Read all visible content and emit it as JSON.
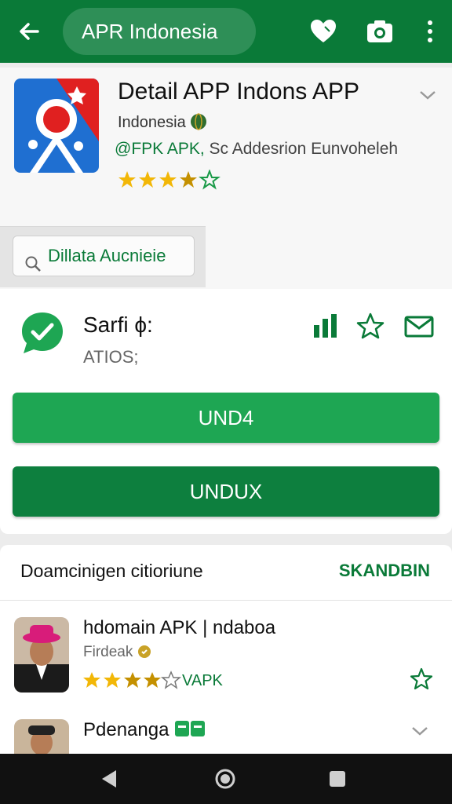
{
  "topbar": {
    "title": "APR Indonesia",
    "icons": [
      "back-arrow-icon",
      "heart-icon",
      "camera-icon",
      "more-vert-icon"
    ],
    "color": "#0a7a38"
  },
  "app": {
    "name": "Detail  APP Indons APP",
    "subtitle": "Indonesia",
    "developer_label": "@FPK APK,",
    "developer_text": "Sc Addesrion Eunvoheleh",
    "rating": 4
  },
  "search_button": {
    "label": "Dillata Aucnieie"
  },
  "card": {
    "title": "Sarfi ϕ:",
    "subtitle": "ATIOS;",
    "button_primary": "UND4",
    "button_secondary": "UNDUX",
    "colors": {
      "primary": "#1ea653",
      "secondary": "#0d7f3e"
    }
  },
  "section": {
    "title": "Doamcinigen citioriune",
    "link": "SKANDBIN",
    "items": [
      {
        "title": "hdomain APK | ndaboa",
        "subtitle": "Firdeak",
        "badge": "VAPK",
        "rating": 4
      },
      {
        "title": "Pdenanga",
        "subtitle": "",
        "badge": "",
        "rating": 0
      }
    ]
  },
  "navbar": {
    "icons": [
      "back-triangle-icon",
      "home-circle-icon",
      "recents-square-icon"
    ]
  }
}
